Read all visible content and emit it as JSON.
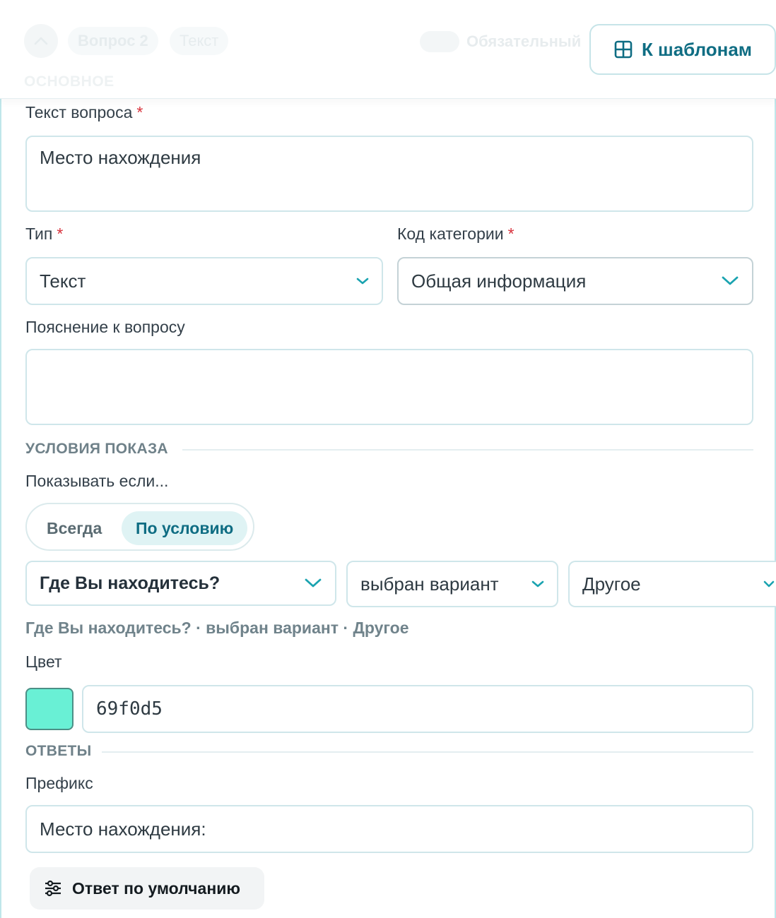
{
  "header": {
    "question_badge": "Вопрос 2",
    "type_badge": "Текст",
    "required_label": "Обязательный",
    "section_basic": "ОСНОВНОЕ",
    "templates_button": "К шаблонам"
  },
  "question_text": {
    "label": "Текст вопроса",
    "required_mark": "*",
    "value": "Место нахождения"
  },
  "type_field": {
    "label": "Тип",
    "required_mark": "*",
    "value": "Текст"
  },
  "category_field": {
    "label": "Код категории",
    "required_mark": "*",
    "value": "Общая информация"
  },
  "explanation": {
    "label": "Пояснение к вопросу",
    "value": ""
  },
  "conditions": {
    "section_title": "УСЛОВИЯ ПОКАЗА",
    "show_if_label": "Показывать если...",
    "options": [
      "Всегда",
      "По условию"
    ],
    "selected_option": "По условию",
    "question_select": "Где Вы находитесь?",
    "operator_select": "выбран вариант",
    "value_select": "Другое",
    "summary": "Где Вы находитесь? · выбран вариант · Другое"
  },
  "color": {
    "label": "Цвет",
    "hex": "69f0d5",
    "swatch_color": "#69f0d5"
  },
  "answers": {
    "section_title": "ОТВЕТЫ",
    "prefix_label": "Префикс",
    "prefix_value": "Место нахождения:",
    "default_button": "Ответ по умолчанию"
  },
  "colors": {
    "accent": "#0f6d83",
    "chevron": "#1aa3b0",
    "border": "#cfe6ea",
    "required": "#d8323c"
  }
}
